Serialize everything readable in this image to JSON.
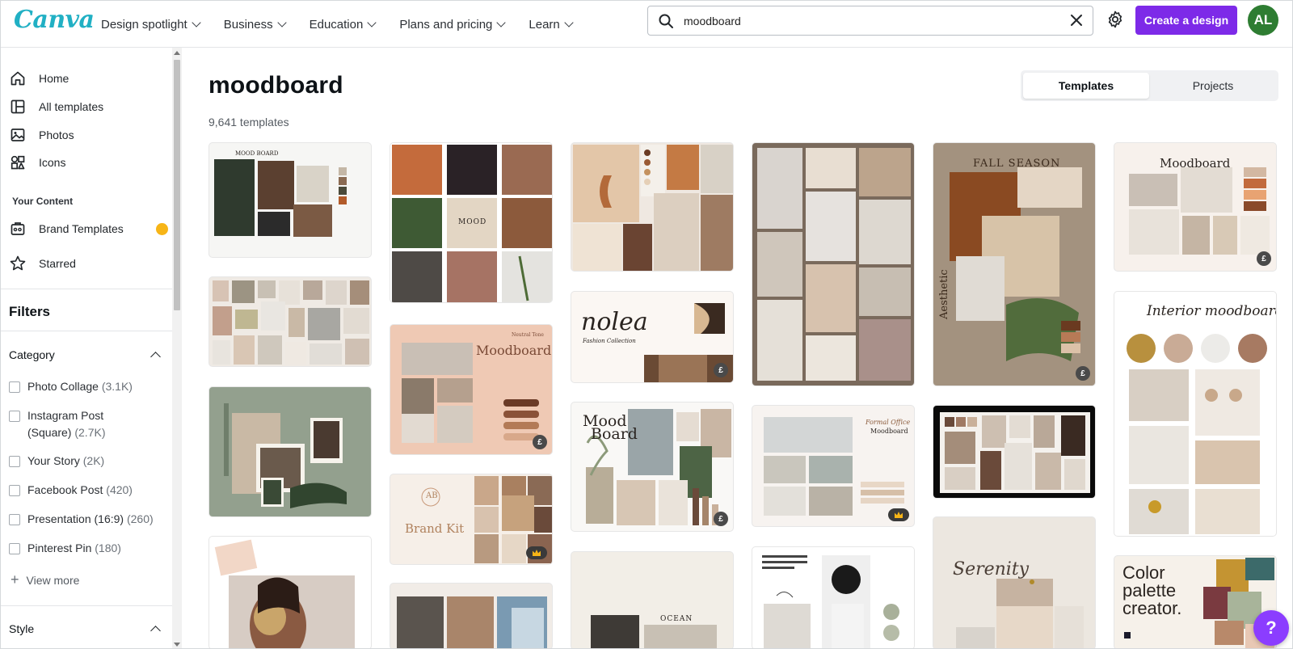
{
  "header": {
    "logo": "Canva",
    "nav": [
      {
        "label": "Design spotlight"
      },
      {
        "label": "Business"
      },
      {
        "label": "Education"
      },
      {
        "label": "Plans and pricing"
      },
      {
        "label": "Learn"
      }
    ],
    "search_value": "moodboard",
    "create_label": "Create a design",
    "avatar_initials": "AL"
  },
  "sidebar": {
    "items": [
      {
        "label": "Home",
        "icon": "home-icon"
      },
      {
        "label": "All templates",
        "icon": "templates-icon"
      },
      {
        "label": "Photos",
        "icon": "photos-icon"
      },
      {
        "label": "Icons",
        "icon": "shapes-icon"
      }
    ],
    "your_content_title": "Your Content",
    "content_items": [
      {
        "label": "Brand Templates",
        "icon": "brand-templates-icon"
      },
      {
        "label": "Starred",
        "icon": "star-icon"
      }
    ],
    "filters_title": "Filters",
    "category_title": "Category",
    "categories": [
      {
        "name": "Photo Collage",
        "count": "(3.1K)"
      },
      {
        "name": "Instagram Post",
        "name2": "(Square)",
        "count": "(2.7K)"
      },
      {
        "name": "Your Story",
        "count": "(2K)"
      },
      {
        "name": "Facebook Post",
        "count": "(420)"
      },
      {
        "name": "Presentation (16:9)",
        "count": "(260)"
      },
      {
        "name": "Pinterest Pin",
        "count": "(180)"
      }
    ],
    "view_more": "View more",
    "style_title": "Style"
  },
  "main": {
    "title": "moodboard",
    "count": "9,641 templates",
    "tabs": [
      {
        "label": "Templates"
      },
      {
        "label": "Projects"
      }
    ]
  },
  "cards": {
    "c1_title": "MOOD BOARD",
    "c2_title": "MOOD",
    "c7_title": "Moodboard",
    "c7_sub": "Neutral Tone",
    "c8_title": "Brand Kit",
    "c8_mono": "AB",
    "c10_title": "nolea",
    "c10_sub": "Fashion Collection",
    "c11_title": "Mood",
    "c11_title2": "Board",
    "c13_title": "FALL SEASON",
    "c13_side": "Aesthetic",
    "c14_title": "Formal Office",
    "c14_sub": "Moodboard",
    "c15_title": "Serenity",
    "c16_title": "Moodboard",
    "c17_title": "Interior moodboard",
    "c18_title": "Color",
    "c18_title2": "palette",
    "c18_title3": "creator.",
    "c12_title": "OCEAN"
  },
  "help_label": "?",
  "colors": {
    "brand": "#7d2ae8",
    "logo": "#21b0c4",
    "avatar": "#2e7d32",
    "crown": "#f7b517"
  }
}
